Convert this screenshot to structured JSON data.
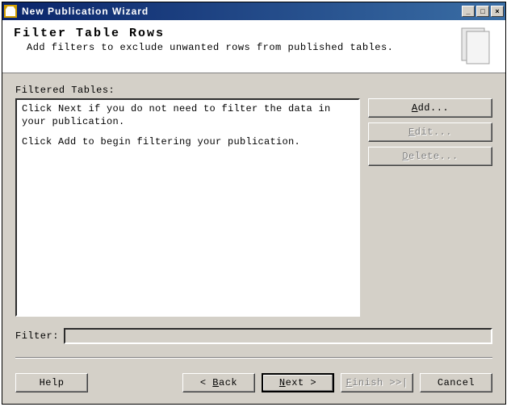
{
  "window": {
    "title": "New Publication Wizard"
  },
  "header": {
    "title": "Filter Table Rows",
    "subtitle": "Add filters to exclude unwanted rows from published tables."
  },
  "section": {
    "label": "Filtered Tables:",
    "placeholder_line1": "Click Next if you do not need to filter the data in your publication.",
    "placeholder_line2": "Click Add to begin filtering your publication."
  },
  "side": {
    "add": "Add...",
    "edit": "Edit...",
    "delete": "Delete..."
  },
  "filter": {
    "label": "Filter:",
    "value": ""
  },
  "footer": {
    "help": "Help",
    "back": "< Back",
    "next": "Next >",
    "finish": "Finish >>|",
    "cancel": "Cancel"
  }
}
